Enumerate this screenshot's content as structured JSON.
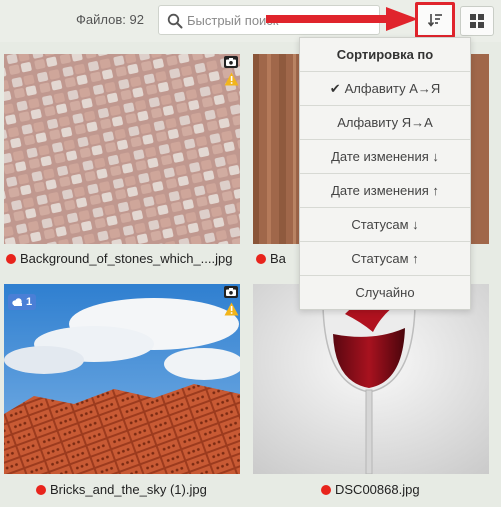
{
  "topbar": {
    "files_label": "Файлов: 92",
    "search_placeholder": "Быстрый поиск"
  },
  "sort_menu": {
    "title": "Сортировка по",
    "options": [
      {
        "label": "Алфавиту А→Я",
        "selected": true
      },
      {
        "label": "Алфавиту Я→А",
        "selected": false
      },
      {
        "label": "Дате изменения ↓",
        "selected": false
      },
      {
        "label": "Дате изменения ↑",
        "selected": false
      },
      {
        "label": "Статусам ↓",
        "selected": false
      },
      {
        "label": "Статусам ↑",
        "selected": false
      },
      {
        "label": "Случайно",
        "selected": false
      }
    ]
  },
  "files": [
    {
      "caption": "Background_of_stones_which_....jpg",
      "status_color": "#e8241c",
      "badges": [
        "camera-icon",
        "warning-icon"
      ]
    },
    {
      "caption": "Ba",
      "status_color": "#e8241c",
      "badges": []
    },
    {
      "caption": "Bricks_and_the_sky (1).jpg",
      "status_color": "#e8241c",
      "badges": [
        "cloud-icon",
        "camera-icon",
        "warning-icon"
      ],
      "cloud_count": "1"
    },
    {
      "caption": "DSC00868.jpg",
      "status_color": "#e8241c",
      "badges": []
    }
  ],
  "colors": {
    "accent_red": "#e0242c",
    "status_red": "#e8241c",
    "cloud_blue": "#4a7fd6",
    "background": "#e7ebe4"
  }
}
